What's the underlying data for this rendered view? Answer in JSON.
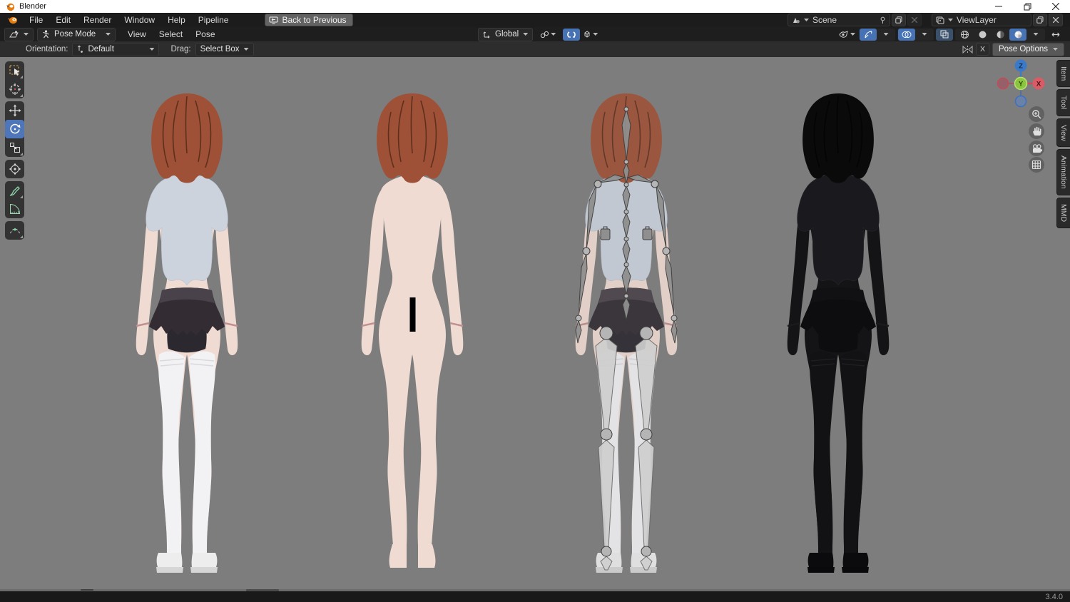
{
  "titlebar": {
    "title": "Blender"
  },
  "menubar": {
    "menus": [
      "File",
      "Edit",
      "Render",
      "Window",
      "Help",
      "Pipeline"
    ],
    "back_button": "Back to Previous"
  },
  "scene_selector": {
    "value": "Scene"
  },
  "viewlayer_selector": {
    "value": "ViewLayer"
  },
  "viewport_header": {
    "mode": "Pose Mode",
    "menus": [
      "View",
      "Select",
      "Pose"
    ],
    "transform_orientation": "Global"
  },
  "tool_settings": {
    "orientation_label": "Orientation:",
    "orientation_value": "Default",
    "drag_label": "Drag:",
    "drag_value": "Select Box",
    "x_mirror": "X",
    "pose_options": "Pose Options"
  },
  "toolbar": {
    "active_tool": "rotate",
    "tools": [
      "select-box",
      "cursor",
      "move",
      "rotate",
      "scale",
      "transform",
      "annotate",
      "measure",
      "pose-breakdowner"
    ]
  },
  "sidebar": {
    "tabs": [
      "Item",
      "Tool",
      "View",
      "Animation",
      "MMD"
    ]
  },
  "nav_gizmo": {
    "axes": {
      "z": "Z",
      "y": "Y",
      "x": "X"
    }
  },
  "statusbar": {
    "version": "3.4.0"
  },
  "viewport": {
    "background": "#7d7d7d",
    "figures": [
      {
        "name": "clothed-model",
        "variant": "clothed"
      },
      {
        "name": "nude-model",
        "variant": "nude",
        "censored": true
      },
      {
        "name": "armature-model",
        "variant": "clothed-bones"
      },
      {
        "name": "wireframe-model",
        "variant": "dark"
      }
    ],
    "palette": {
      "hair": "#9e5136",
      "hair_dark": "#5f2f1d",
      "skin": "#f0dbd2",
      "shirt": "#ccd3dd",
      "skirt": "#332d33",
      "skirt_band": "#4a424a",
      "shorts": "#2c2830",
      "stockings": "#f2f2f4",
      "stock_band": "#d9d9dd",
      "shoes": "#ededed",
      "sole": "#d6d6d6",
      "bracelet": "#c09090",
      "bone": "#8f8f8f",
      "leg_bone": "#cfcfcf",
      "joint": "#b5b5b5",
      "dark_body": "#141417",
      "dark_hair": "#0a0a0b",
      "dark_cloth": "#1a1a1e",
      "dark_skirt": "#0d0d10",
      "censor": "#000000"
    }
  },
  "colors": {
    "accent": "#4772b3",
    "axis_x": "#d85c66",
    "axis_y": "#7bbf2e",
    "axis_z": "#3a7ac8"
  }
}
